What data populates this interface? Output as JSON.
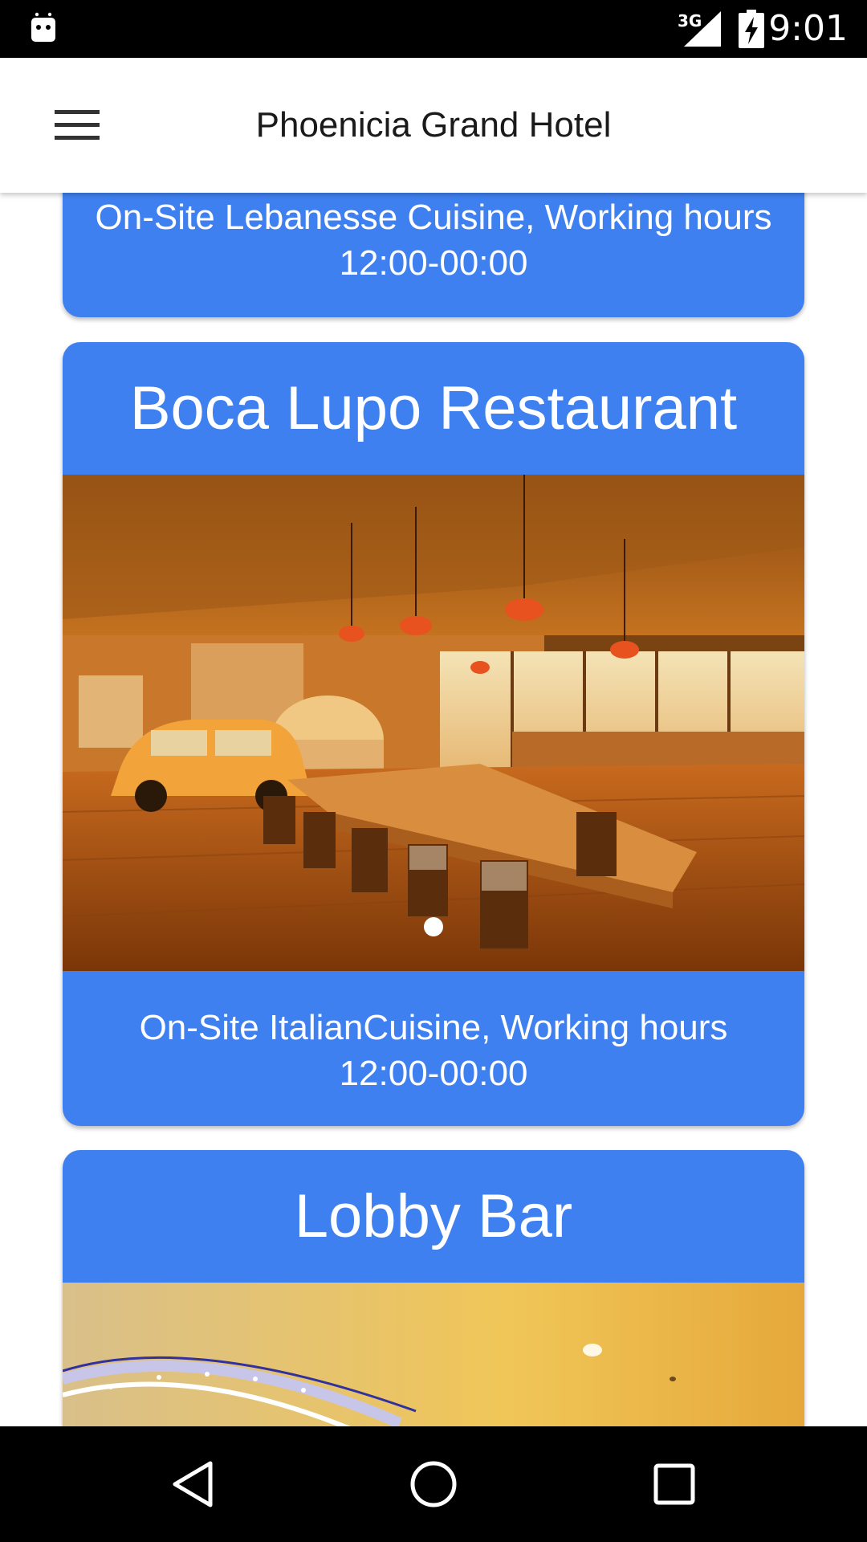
{
  "status_bar": {
    "network_type": "3G",
    "time": "9:01",
    "icons": [
      "android-debug-icon",
      "signal-icon",
      "battery-charging-icon"
    ]
  },
  "app_bar": {
    "title": "Phoenicia Grand Hotel",
    "menu_icon": "hamburger-menu-icon"
  },
  "cards": [
    {
      "description": "On-Site Lebanesse Cuisine, Working hours 12:00-00:00"
    },
    {
      "title": "Boca Lupo Restaurant",
      "photo": "restaurant-interior-photo",
      "description": "On-Site ItalianCuisine, Working hours 12:00-00:00",
      "carousel_position": 1
    },
    {
      "title": "Lobby Bar",
      "photo": "lobby-bar-photo"
    }
  ],
  "nav_bar": {
    "icons": [
      "back-icon",
      "home-icon",
      "recents-icon"
    ]
  },
  "colors": {
    "card_background": "#3f80f1",
    "card_text": "#ffffff",
    "status_bar": "#000000",
    "app_bar": "#ffffff"
  }
}
